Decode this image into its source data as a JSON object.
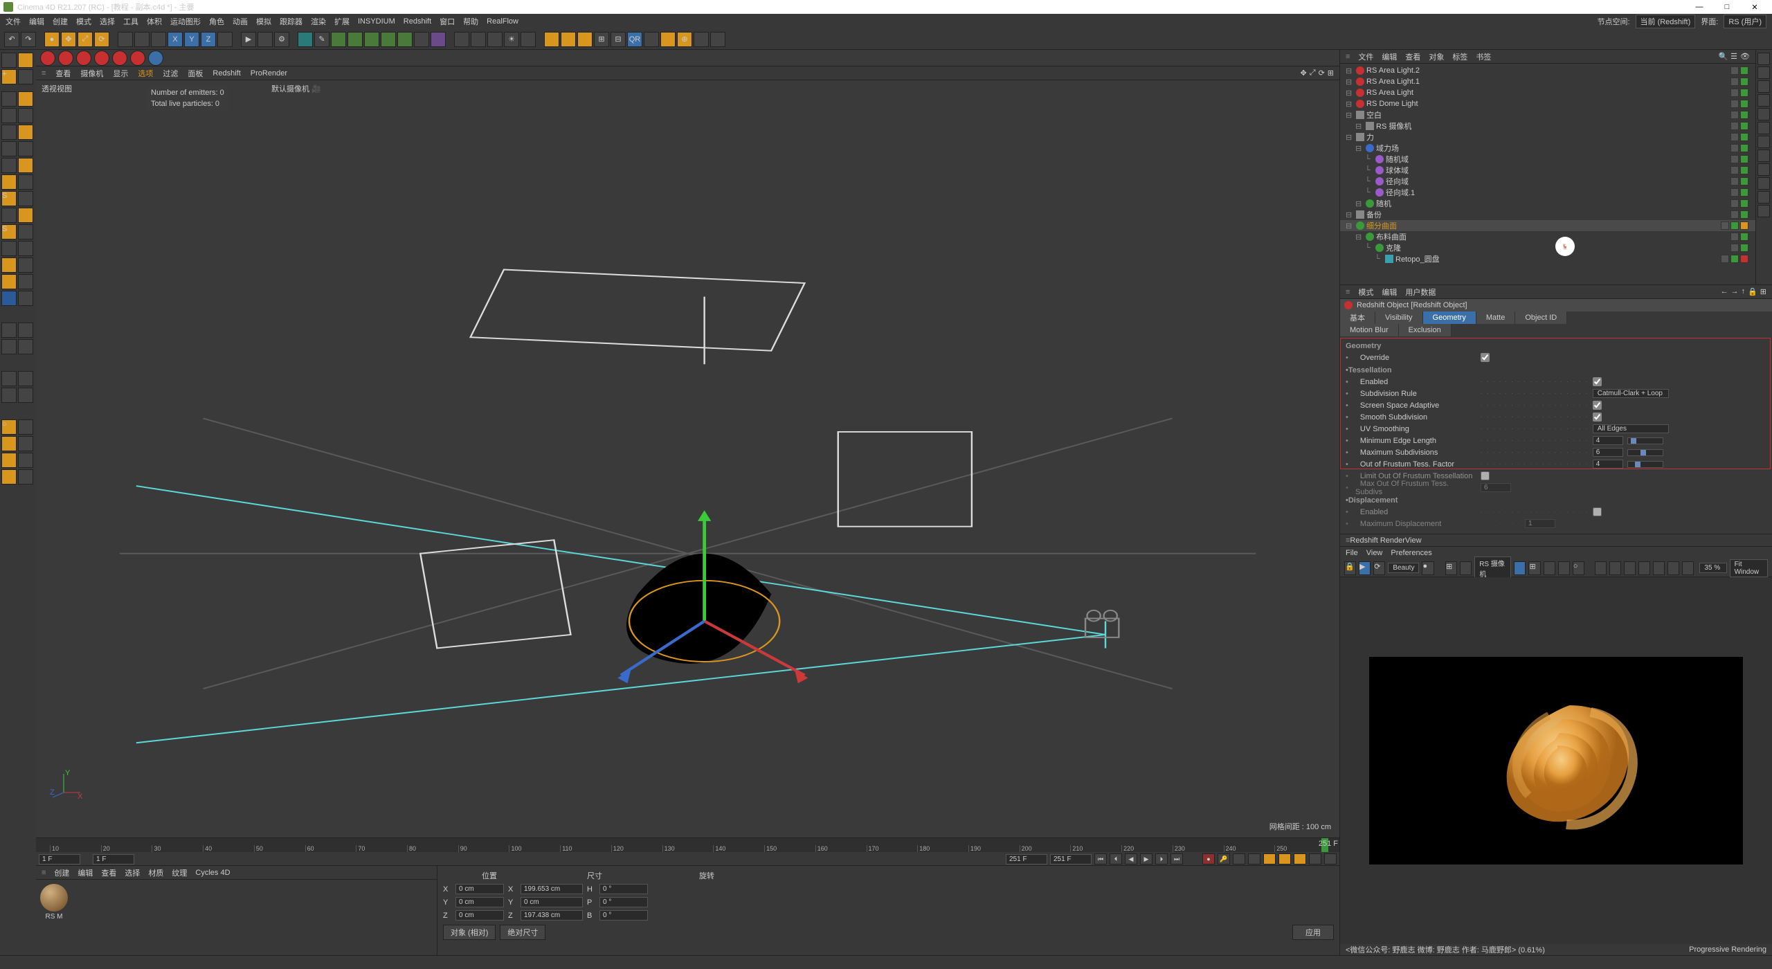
{
  "title": "Cinema 4D R21.207 (RC) - [教程 - 副本.c4d *] - 主要",
  "menus": [
    "文件",
    "编辑",
    "创建",
    "模式",
    "选择",
    "工具",
    "体积",
    "运动图形",
    "角色",
    "动画",
    "模拟",
    "跟踪器",
    "渲染",
    "扩展",
    "INSYDIUM",
    "Redshift",
    "窗口",
    "帮助",
    "RealFlow"
  ],
  "menubar_right": {
    "ns_label": "节点空间:",
    "ns_value": "当前 (Redshift)",
    "ui_label": "界面:",
    "ui_value": "RS (用户)"
  },
  "viewport": {
    "menus": [
      "查看",
      "摄像机",
      "显示",
      "选项",
      "过滤",
      "面板",
      "Redshift",
      "ProRender"
    ],
    "title": "透视视图",
    "camera": "默认摄像机",
    "emitters": "Number of emitters: 0",
    "particles": "Total live particles: 0",
    "grid": "网格间距 : 100 cm",
    "axes": {
      "x": "X",
      "y": "Y",
      "z": "Z"
    }
  },
  "timeline": {
    "start": "1 F",
    "end": "251 F",
    "cur": "251 F",
    "cur2": "251 F",
    "ticks": [
      "10",
      "20",
      "30",
      "40",
      "50",
      "60",
      "70",
      "80",
      "90",
      "100",
      "110",
      "120",
      "130",
      "140",
      "150",
      "160",
      "170",
      "180",
      "190",
      "200",
      "210",
      "220",
      "230",
      "240",
      "250"
    ]
  },
  "mat": {
    "menus": [
      "创建",
      "编辑",
      "查看",
      "选择",
      "材质",
      "纹理",
      "Cycles 4D"
    ],
    "name": "RS M"
  },
  "coords": {
    "headers": [
      "位置",
      "尺寸",
      "旋转"
    ],
    "rows": [
      {
        "axis": "X",
        "pos": "0 cm",
        "size": "199.653 cm",
        "rot": "0 °",
        "rotlbl": "H"
      },
      {
        "axis": "Y",
        "pos": "0 cm",
        "size": "0 cm",
        "rot": "0 °",
        "rotlbl": "P"
      },
      {
        "axis": "Z",
        "pos": "0 cm",
        "size": "197.438 cm",
        "rot": "0 °",
        "rotlbl": "B"
      }
    ],
    "mode1": "对象 (相对)",
    "mode2": "绝对尺寸",
    "apply": "应用"
  },
  "objmgr": {
    "menus": [
      "文件",
      "编辑",
      "查看",
      "对象",
      "标签",
      "书签"
    ],
    "items": [
      {
        "name": "RS Area Light.2",
        "indent": 0,
        "ico": "red"
      },
      {
        "name": "RS Area Light.1",
        "indent": 0,
        "ico": "red"
      },
      {
        "name": "RS Area Light",
        "indent": 0,
        "ico": "red"
      },
      {
        "name": "RS Dome Light",
        "indent": 0,
        "ico": "red"
      },
      {
        "name": "空白",
        "indent": 0,
        "ico": "gray"
      },
      {
        "name": "RS 摄像机",
        "indent": 1,
        "ico": "gray"
      },
      {
        "name": "力",
        "indent": 0,
        "ico": "gray"
      },
      {
        "name": "域力场",
        "indent": 1,
        "ico": "blue"
      },
      {
        "name": "随机域",
        "indent": 2,
        "ico": "purple"
      },
      {
        "name": "球体域",
        "indent": 2,
        "ico": "purple"
      },
      {
        "name": "径向域",
        "indent": 2,
        "ico": "purple"
      },
      {
        "name": "径向域.1",
        "indent": 2,
        "ico": "purple"
      },
      {
        "name": "随机",
        "indent": 1,
        "ico": "green"
      },
      {
        "name": "备份",
        "indent": 0,
        "ico": "gray"
      },
      {
        "name": "细分曲面",
        "indent": 0,
        "ico": "green",
        "sel": true,
        "extra": "orange"
      },
      {
        "name": "布料曲面",
        "indent": 1,
        "ico": "green"
      },
      {
        "name": "克隆",
        "indent": 2,
        "ico": "green"
      },
      {
        "name": "Retopo_圆盘",
        "indent": 3,
        "ico": "cyan",
        "extra": "red"
      }
    ]
  },
  "attr": {
    "menus": [
      "模式",
      "编辑",
      "用户数据"
    ],
    "object": "Redshift Object [Redshift Object]",
    "tabs1": [
      "基本",
      "Visibility",
      "Geometry",
      "Matte",
      "Object ID"
    ],
    "tabs2": [
      "Motion Blur",
      "Exclusion"
    ],
    "active_tab": "Geometry",
    "sections": {
      "geometry": "Geometry",
      "tess": "•Tessellation",
      "disp": "•Displacement"
    },
    "rows": {
      "override": {
        "label": "Override",
        "checked": true
      },
      "enabled": {
        "label": "Enabled",
        "checked": true
      },
      "subdiv_rule": {
        "label": "Subdivision Rule",
        "value": "Catmull-Clark + Loop"
      },
      "ssa": {
        "label": "Screen Space Adaptive",
        "checked": true
      },
      "smooth": {
        "label": "Smooth Subdivision",
        "checked": true
      },
      "uv": {
        "label": "UV Smoothing",
        "value": "All Edges"
      },
      "min_edge": {
        "label": "Minimum Edge Length",
        "value": "4"
      },
      "max_sub": {
        "label": "Maximum Subdivisions",
        "value": "6"
      },
      "oof": {
        "label": "Out of Frustum Tess. Factor",
        "value": "4"
      },
      "limit": {
        "label": "Limit Out Of Frustum Tessellation",
        "checked": false
      },
      "max_oof": {
        "label": "Max Out Of Frustum Tess. Subdivs",
        "value": "6"
      },
      "disp_enabled": {
        "label": "Enabled",
        "checked": false
      },
      "max_disp": {
        "label": "Maximum Displacement",
        "value": "1"
      }
    }
  },
  "render": {
    "title": "Redshift RenderView",
    "menus": [
      "File",
      "View",
      "Preferences"
    ],
    "pass": "Beauty",
    "camera": "RS 摄像机",
    "zoom": "35 %",
    "fit": "Fit Window",
    "status_l": "<微信公众号: 野鹿志  微博: 野鹿志  作者: 马鹿野郎>  (0.61%)",
    "status_r": "Progressive Rendering"
  }
}
